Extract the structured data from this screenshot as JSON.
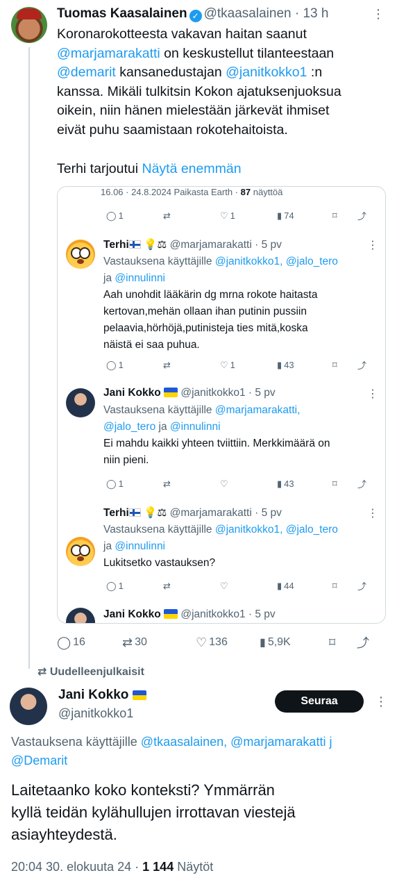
{
  "main_tweet": {
    "name": "Tuomas Kaasalainen",
    "handle": "@tkaasalainen",
    "time": "· 13 h",
    "text_lines": [
      "Koronarokotteesta vakavan haitan saanut",
      "@marjamarakatti on keskustellut tilanteestaan",
      "@demarit kansanedustajan @janitkokko1 :n",
      "kanssa. Mikäli tulkitsin Kokon ajatuksenjuoksua",
      "oikein, niin hänen mielestään järkevät ihmiset",
      "eivät puhu saamistaan rokotehaitoista."
    ],
    "mention_marjamarakatti": "@marjamarakatti",
    "seg_on": " on keskustellut tilanteestaan",
    "mention_demarit": "@demarit",
    "seg_kansane": " kansanedustajan ",
    "mention_janitkokko": "@janitkokko1",
    "seg_n": " :n",
    "seg_line1": "Koronarokotteesta vakavan haitan saanut",
    "seg_line4": "kanssa. Mikäli tulkitsin Kokon ajatuksenjuoksua",
    "seg_line5": "oikein, niin hänen mielestään järkevät ihmiset",
    "seg_line6": "eivät puhu saamistaan rokotehaitoista.",
    "last_line": "Terhi tarjoutui",
    "show_more": "Näytä enemmän",
    "stats": {
      "replies": "16",
      "reposts": "30",
      "likes": "136",
      "views": "5,9K"
    }
  },
  "card": {
    "top_meta": "16.06 · 24.8.2024 Paikasta Earth ·",
    "top_views_num": "87",
    "top_views_label": "näyttöä",
    "first_actions": {
      "replies": "1",
      "likes": "1",
      "views": "74"
    },
    "replies": [
      {
        "name": "Terhi",
        "handle": "@marjamarakatti · 5 pv",
        "replying_prefix": "Vastauksena käyttäjille",
        "mentions_a": "@janitkokko1, @jalo_tero",
        "mentions_b_prefix": "ja",
        "mentions_b": "@innulinni",
        "text_lines": [
          "Aah unohdit lääkärin dg mrna rokote haitasta",
          "kertovan,mehän ollaan ihan putinin pussiin",
          "pelaavia,hörhöjä,putinisteja ties mitä,koska",
          "näistä ei saa puhua."
        ],
        "replies": "1",
        "likes": "1",
        "views": "43"
      },
      {
        "name": "Jani Kokko",
        "handle": "@janitkokko1 · 5 pv",
        "replying_prefix": "Vastauksena käyttäjille",
        "mentions_a": "@marjamarakatti,",
        "mentions_b_prefix": "ja",
        "mentions_b1": "@jalo_tero",
        "mentions_b2": "@innulinni",
        "text_lines": [
          "Ei mahdu kaikki yhteen tviittiin. Merkkimäärä on",
          "niin pieni."
        ],
        "replies": "1",
        "likes": "",
        "views": "43"
      },
      {
        "name": "Terhi",
        "handle": "@marjamarakatti · 5 pv",
        "replying_prefix": "Vastauksena käyttäjille",
        "mentions_a": "@janitkokko1, @jalo_tero",
        "mentions_b_prefix": "ja",
        "mentions_b": "@innulinni",
        "text_lines": [
          "Lukitsetko vastauksen?"
        ],
        "replies": "1",
        "likes": "",
        "views": "44"
      },
      {
        "name": "Jani Kokko",
        "handle": "@janitkokko1 · 5 pv"
      }
    ]
  },
  "repost_label": "Uudelleenjulkaisit",
  "second_tweet": {
    "name": "Jani Kokko",
    "handle": "@janitkokko1",
    "follow_label": "Seuraa",
    "replying_prefix": "Vastauksena käyttäjille",
    "replying_mentions": "@tkaasalainen, @marjamarakatti j",
    "replying_line2": "@Demarit",
    "text_lines": [
      "Laitetaanko koko konteksti? Ymmärrän",
      "kyllä teidän kylähullujen irrottavan viestejä",
      "asiayhteydestä."
    ],
    "time": "20:04 30. elokuuta 24 ·",
    "views_num": "1 144",
    "views_label": "Näytöt"
  }
}
